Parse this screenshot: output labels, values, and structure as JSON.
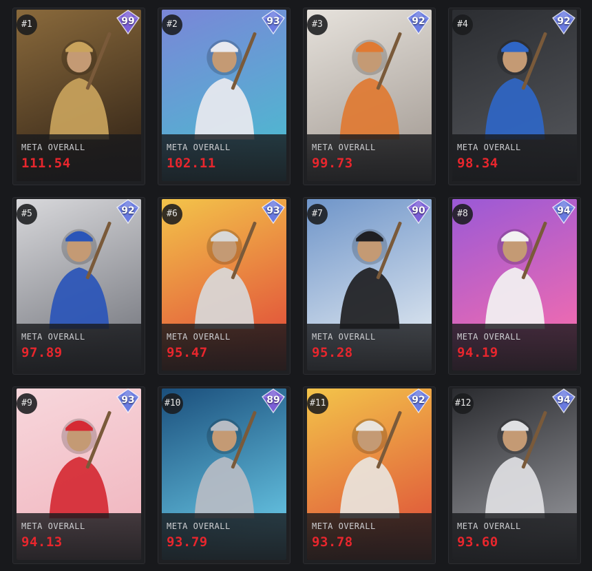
{
  "cards": [
    {
      "rank": "#1",
      "ovr": "99",
      "label": "META OVERALL",
      "value": "111.54",
      "gem": "#7b5fd6",
      "bg": [
        "#8a6a3c",
        "#3a2a1a"
      ],
      "accent": "#c9a35c"
    },
    {
      "rank": "#2",
      "ovr": "93",
      "label": "META OVERALL",
      "value": "102.11",
      "gem": "#6a7be0",
      "bg": [
        "#7a86d8",
        "#4fb7d0"
      ],
      "accent": "#e9e9ef"
    },
    {
      "rank": "#3",
      "ovr": "92",
      "label": "META OVERALL",
      "value": "99.73",
      "gem": "#6a7be0",
      "bg": [
        "#e6e2dc",
        "#a9a19a"
      ],
      "accent": "#e07a32"
    },
    {
      "rank": "#4",
      "ovr": "92",
      "label": "META OVERALL",
      "value": "98.34",
      "gem": "#6a7be0",
      "bg": [
        "#2b2d31",
        "#505257"
      ],
      "accent": "#2f66c6"
    },
    {
      "rank": "#5",
      "ovr": "92",
      "label": "META OVERALL",
      "value": "97.89",
      "gem": "#6a7be0",
      "bg": [
        "#d8d8db",
        "#7d7f86"
      ],
      "accent": "#2a55b8"
    },
    {
      "rank": "#6",
      "ovr": "93",
      "label": "META OVERALL",
      "value": "95.47",
      "gem": "#6a7be0",
      "bg": [
        "#f3c44a",
        "#e2553a"
      ],
      "accent": "#d8d8d8"
    },
    {
      "rank": "#7",
      "ovr": "90",
      "label": "META OVERALL",
      "value": "95.28",
      "gem": "#7b5fd6",
      "bg": [
        "#6f95c9",
        "#d9e3ee"
      ],
      "accent": "#1f1f22"
    },
    {
      "rank": "#8",
      "ovr": "94",
      "label": "META OVERALL",
      "value": "94.19",
      "gem": "#6a7be0",
      "bg": [
        "#9a59d6",
        "#f06bb0"
      ],
      "accent": "#f2f2f2"
    },
    {
      "rank": "#9",
      "ovr": "93",
      "label": "META OVERALL",
      "value": "94.13",
      "gem": "#6a7be0",
      "bg": [
        "#f7d7dc",
        "#f1b7c0"
      ],
      "accent": "#d52a34"
    },
    {
      "rank": "#10",
      "ovr": "89",
      "label": "META OVERALL",
      "value": "93.79",
      "gem": "#7b5fd6",
      "bg": [
        "#1b4f7c",
        "#64c1e0"
      ],
      "accent": "#b7bcc4"
    },
    {
      "rank": "#11",
      "ovr": "92",
      "label": "META OVERALL",
      "value": "93.78",
      "gem": "#6a7be0",
      "bg": [
        "#f3c44a",
        "#e05a3a"
      ],
      "accent": "#e9e4dc"
    },
    {
      "rank": "#12",
      "ovr": "94",
      "label": "META OVERALL",
      "value": "93.60",
      "gem": "#6a7be0",
      "bg": [
        "#2a2b2f",
        "#8c8d92"
      ],
      "accent": "#dfe0e3"
    }
  ]
}
